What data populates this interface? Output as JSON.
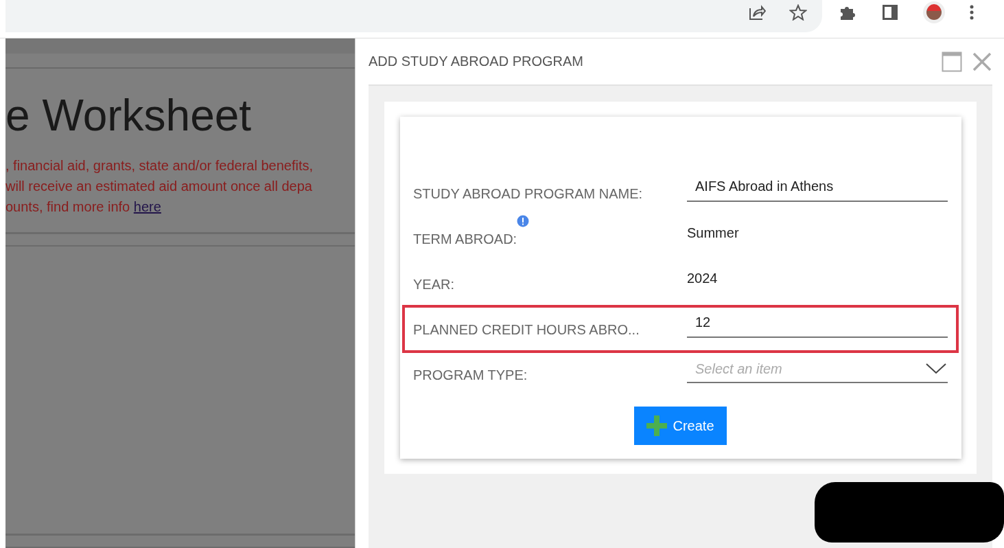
{
  "page": {
    "heading": "e Worksheet",
    "lines": [
      ", financial aid, grants, state and/or federal benefits,",
      " will receive an estimated aid amount once all depa",
      "ounts, find more info "
    ],
    "link": "here "
  },
  "dialog": {
    "title": "ADD STUDY ABROAD PROGRAM",
    "fields": [
      {
        "label": "STUDY ABROAD PROGRAM NAME:",
        "kind": "input",
        "value": "AIFS Abroad in Athens",
        "info": false,
        "highlighted": false
      },
      {
        "label": "TERM ABROAD:",
        "kind": "text",
        "value": "Summer",
        "info": true,
        "highlighted": false
      },
      {
        "label": "YEAR:",
        "kind": "text",
        "value": "2024",
        "info": false,
        "highlighted": false
      },
      {
        "label": "PLANNED CREDIT HOURS ABRO...",
        "kind": "input",
        "value": "12",
        "info": false,
        "highlighted": true
      },
      {
        "label": "PROGRAM TYPE:",
        "kind": "dropdown",
        "placeholder": "Select an item",
        "info": false,
        "highlighted": false
      }
    ],
    "button": "Create"
  }
}
